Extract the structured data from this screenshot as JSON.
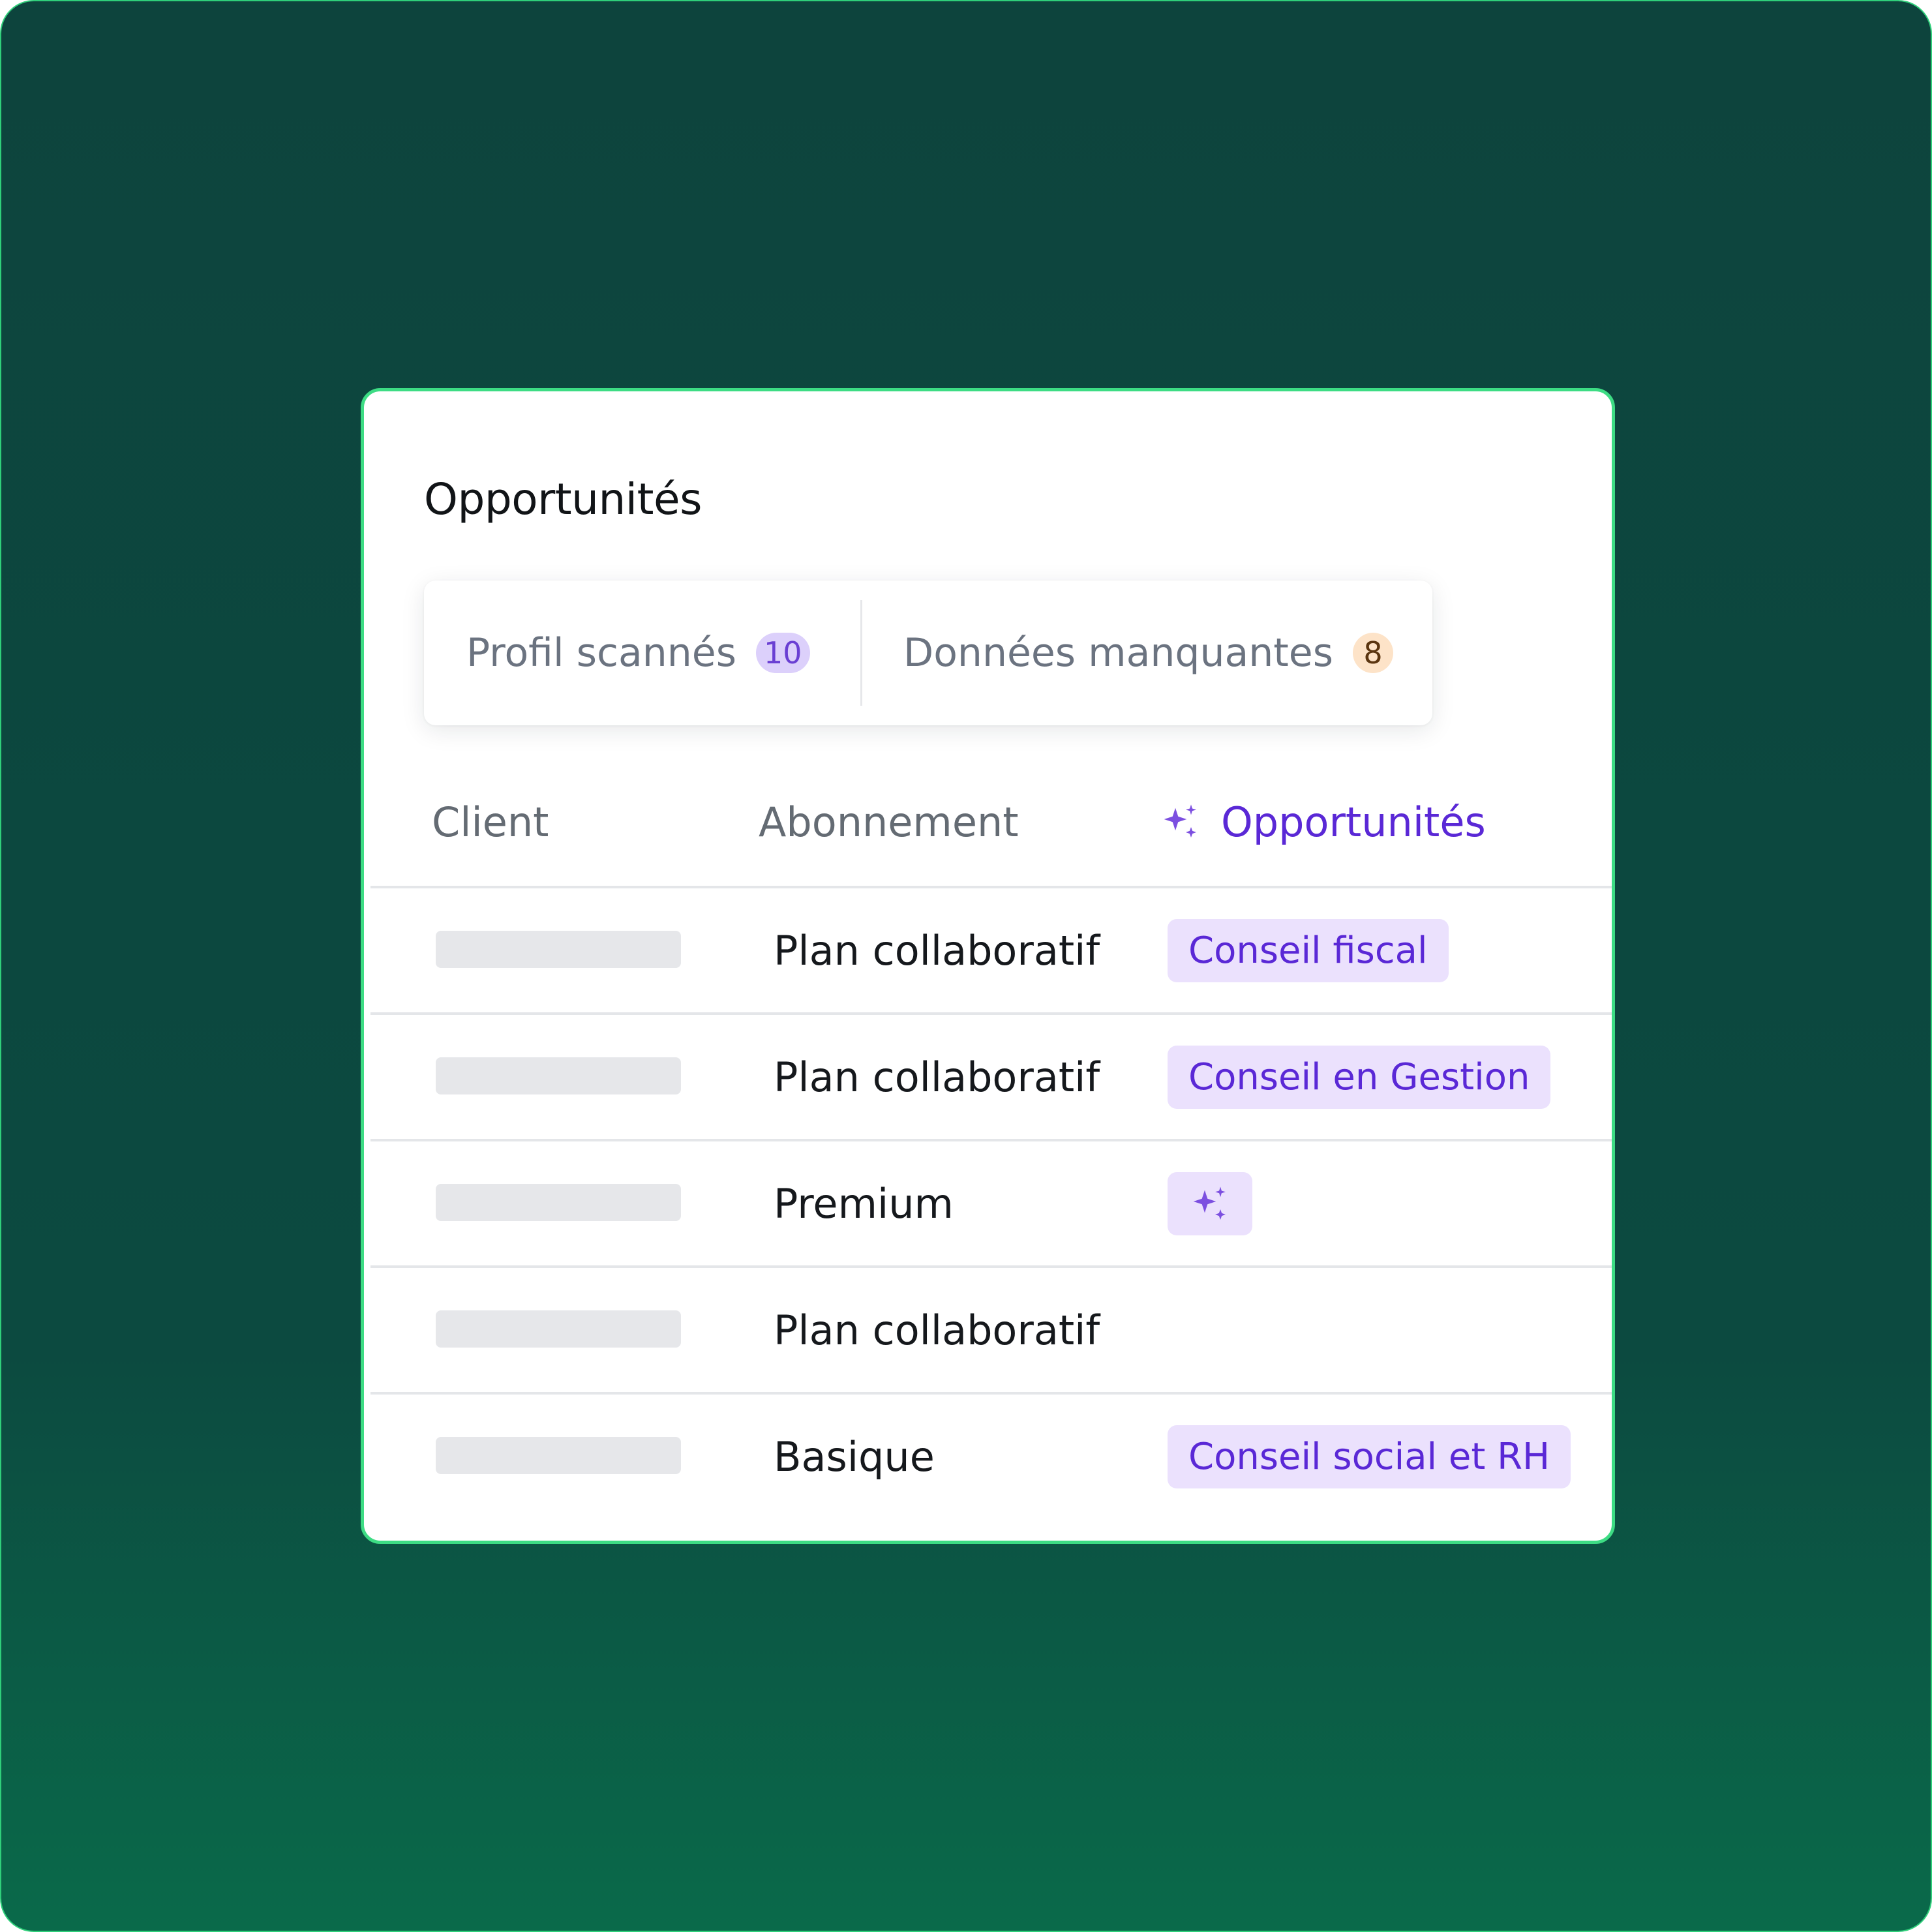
{
  "card": {
    "title": "Opportunités"
  },
  "stats": [
    {
      "label": "Profil scannés",
      "count": "10",
      "badge_color": "#dcd0fb"
    },
    {
      "label": "Données manquantes",
      "count": "8",
      "badge_color": "#fde3c8"
    }
  ],
  "table": {
    "headers": {
      "client": "Client",
      "abonnement": "Abonnement",
      "opportunites": "Opportunités",
      "opportunites_icon": "sparkles-icon"
    },
    "rows": [
      {
        "client": "",
        "abonnement": "Plan collaboratif",
        "opportunite": "Conseil fiscal"
      },
      {
        "client": "",
        "abonnement": "Plan collaboratif",
        "opportunite": "Conseil en Gestion"
      },
      {
        "client": "",
        "abonnement": "Premium",
        "opportunite_icon": "sparkles-icon"
      },
      {
        "client": "",
        "abonnement": "Plan collaboratif",
        "opportunite": ""
      },
      {
        "client": "",
        "abonnement": "Basique",
        "opportunite": "Conseil social et RH"
      }
    ]
  },
  "colors": {
    "background": "#0d443d",
    "card_border": "#3ddc84",
    "accent_purple": "#5a28d6",
    "tag_background": "#ebe1fd",
    "placeholder": "#e6e7ea"
  }
}
